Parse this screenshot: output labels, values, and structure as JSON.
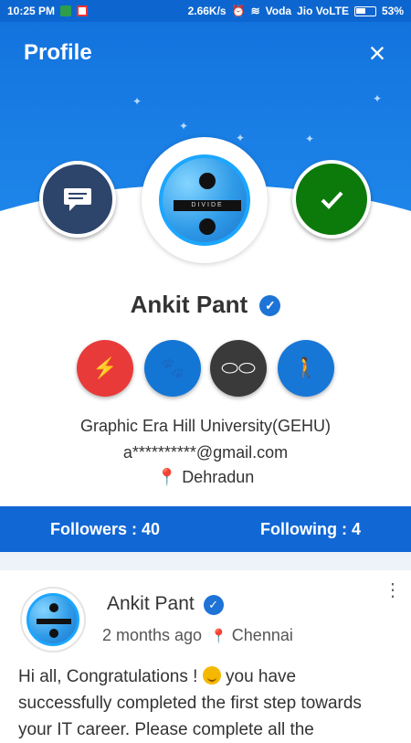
{
  "status_bar": {
    "time": "10:25 PM",
    "network_speed": "2.66K/s",
    "carrier_1": "Voda",
    "carrier_2": "Jio VoLTE",
    "battery": "53%"
  },
  "header": {
    "title": "Profile",
    "close_icon": "close-icon"
  },
  "profile": {
    "name": "Ankit Pant",
    "university": "Graphic Era Hill University(GEHU)",
    "email": "a**********@gmail.com",
    "location": "Dehradun",
    "avatar_art_text": "DIVIDE",
    "verified_icon": "verified-icon"
  },
  "stats": {
    "followers": "Followers : 40",
    "following": "Following : 4"
  },
  "post": {
    "author": "Ankit Pant",
    "time": "2 months ago",
    "location": "Chennai",
    "text_1": "Hi all, Congratulations ! ",
    "text_2": " you have successfully completed the first step towards your IT career. Please complete all the"
  },
  "icons": {
    "chat": "chat-icon",
    "check": "check-icon",
    "lightning": "lightning-icon",
    "paw": "paw-icon",
    "sunglasses": "sunglasses-icon",
    "walker": "walker-icon",
    "location_pin": "location-pin-icon",
    "more": "more-options-icon"
  }
}
